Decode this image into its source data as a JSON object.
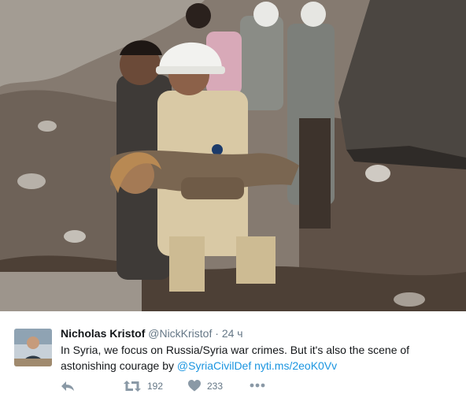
{
  "photo": {
    "alt": ""
  },
  "tweet": {
    "author_name": "Nicholas Kristof",
    "author_handle": "@NickKristof",
    "separator": "·",
    "time": "24 ч",
    "text": "In Syria, we focus on Russia/Syria war crimes. But it's also the scene of astonishing courage by",
    "mention": "@SyriaCivilDef",
    "url": "nyti.ms/2eoK0Vv"
  },
  "actions": {
    "retweet_count": "192",
    "like_count": "233"
  },
  "icons": {
    "reply": "reply-icon",
    "retweet": "retweet-icon",
    "like": "heart-icon",
    "more": "more-dots-icon"
  },
  "colors": {
    "link": "#1b95e0",
    "action": "#8a99a6",
    "text": "#14171a",
    "muted": "#657786"
  }
}
